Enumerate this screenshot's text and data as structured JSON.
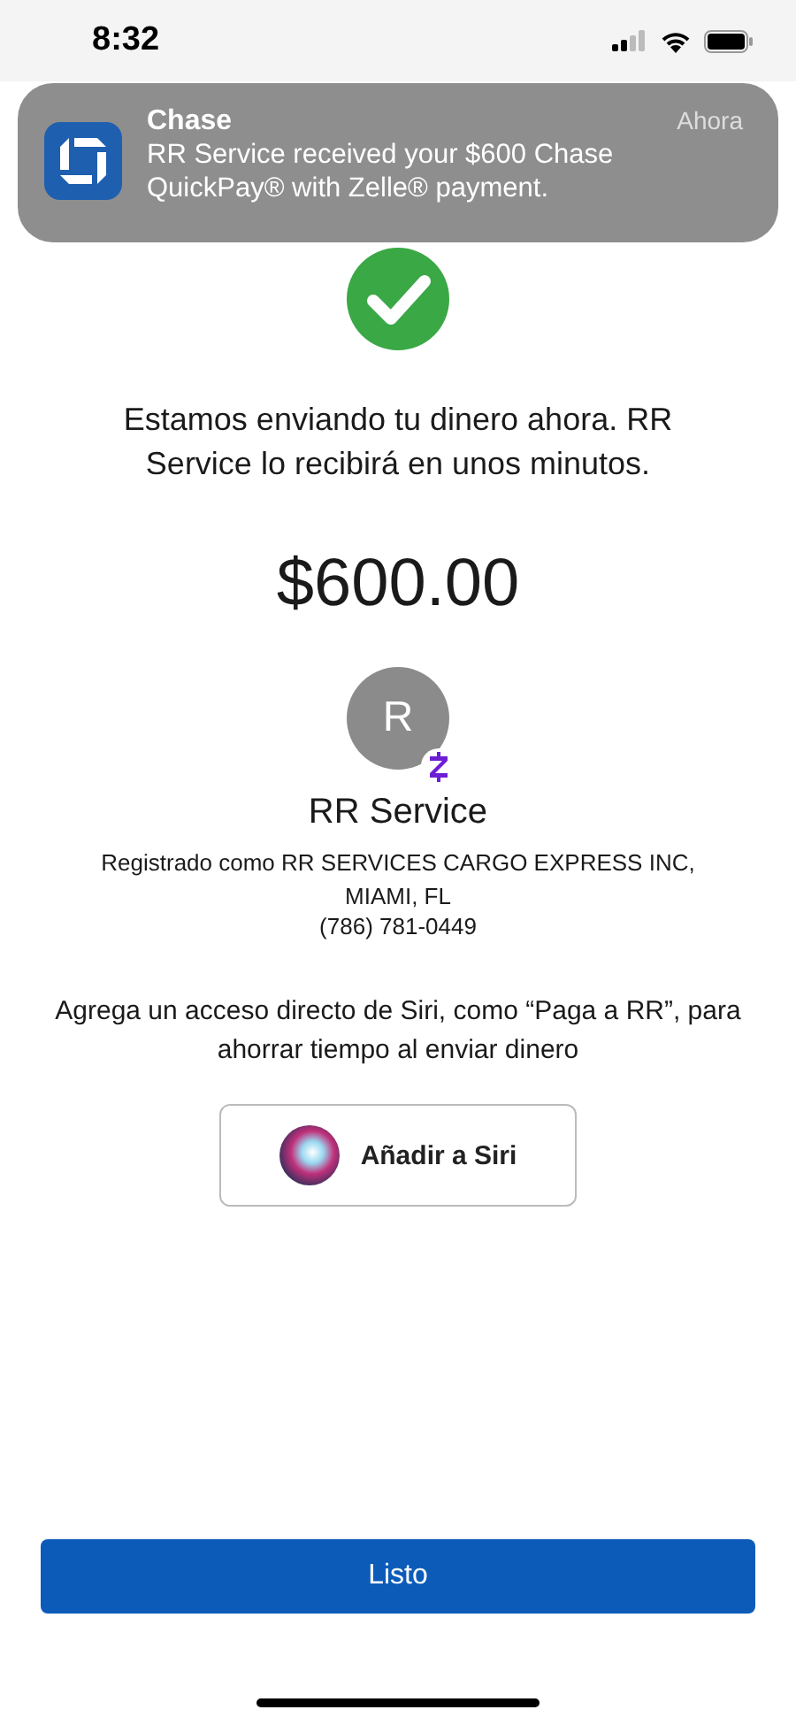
{
  "status_bar": {
    "time": "8:32"
  },
  "notification": {
    "app": "Chase",
    "time": "Ahora",
    "message": "RR Service received your $600 Chase QuickPay® with Zelle® payment."
  },
  "confirmation": {
    "message": "Estamos enviando tu dinero ahora. RR Service lo recibirá en unos minutos.",
    "amount": "$600.00"
  },
  "recipient": {
    "initial": "R",
    "name": "RR Service",
    "registration": "Registrado como RR SERVICES CARGO EXPRESS INC, MIAMI, FL",
    "phone": "(786) 781-0449"
  },
  "siri": {
    "prompt": "Agrega un acceso directo de Siri, como “Paga a RR”, para ahorrar tiempo al enviar dinero",
    "button": "Añadir a Siri"
  },
  "done_button": "Listo"
}
